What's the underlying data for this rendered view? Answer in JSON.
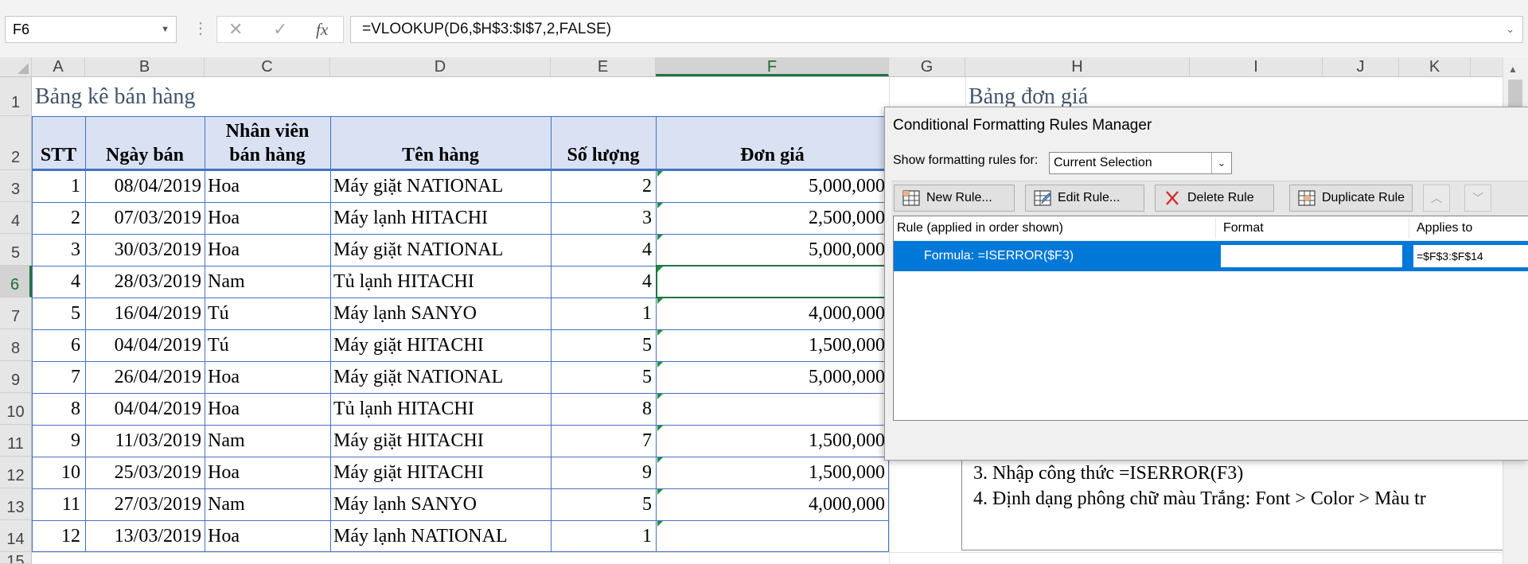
{
  "formula_bar": {
    "name_box": "F6",
    "cancel_icon": "✕",
    "enter_icon": "✓",
    "fx_label": "fx",
    "formula": "=VLOOKUP(D6,$H$3:$I$7,2,FALSE)"
  },
  "columns": [
    "A",
    "B",
    "C",
    "D",
    "E",
    "F",
    "G",
    "H",
    "I",
    "J",
    "K"
  ],
  "row_numbers": [
    "1",
    "2",
    "3",
    "4",
    "5",
    "6",
    "7",
    "8",
    "9",
    "10",
    "11",
    "12",
    "13",
    "14",
    "15"
  ],
  "sheet": {
    "title_left": "Bảng kê bán hàng",
    "title_right": "Bảng đơn giá",
    "headers": {
      "stt": "STT",
      "ngay_ban": "Ngày bán",
      "nhan_vien_line1": "Nhân viên",
      "nhan_vien_line2": "bán hàng",
      "ten_hang": "Tên hàng",
      "so_luong": "Số lượng",
      "don_gia": "Đơn giá"
    },
    "rows": [
      {
        "stt": "1",
        "ngay": "08/04/2019",
        "nv": "Hoa",
        "hang": "Máy giặt NATIONAL",
        "sl": "2",
        "gia": "5,000,000"
      },
      {
        "stt": "2",
        "ngay": "07/03/2019",
        "nv": "Hoa",
        "hang": "Máy lạnh HITACHI",
        "sl": "3",
        "gia": "2,500,000"
      },
      {
        "stt": "3",
        "ngay": "30/03/2019",
        "nv": "Hoa",
        "hang": "Máy giặt NATIONAL",
        "sl": "4",
        "gia": "5,000,000"
      },
      {
        "stt": "4",
        "ngay": "28/03/2019",
        "nv": "Nam",
        "hang": "Tủ lạnh HITACHI",
        "sl": "4",
        "gia": ""
      },
      {
        "stt": "5",
        "ngay": "16/04/2019",
        "nv": "Tú",
        "hang": "Máy lạnh SANYO",
        "sl": "1",
        "gia": "4,000,000"
      },
      {
        "stt": "6",
        "ngay": "04/04/2019",
        "nv": "Tú",
        "hang": "Máy giặt HITACHI",
        "sl": "5",
        "gia": "1,500,000"
      },
      {
        "stt": "7",
        "ngay": "26/04/2019",
        "nv": "Hoa",
        "hang": "Máy giặt NATIONAL",
        "sl": "5",
        "gia": "5,000,000"
      },
      {
        "stt": "8",
        "ngay": "04/04/2019",
        "nv": "Hoa",
        "hang": "Tủ lạnh HITACHI",
        "sl": "8",
        "gia": ""
      },
      {
        "stt": "9",
        "ngay": "11/03/2019",
        "nv": "Nam",
        "hang": "Máy giặt HITACHI",
        "sl": "7",
        "gia": "1,500,000"
      },
      {
        "stt": "10",
        "ngay": "25/03/2019",
        "nv": "Hoa",
        "hang": "Máy giặt HITACHI",
        "sl": "9",
        "gia": "1,500,000"
      },
      {
        "stt": "11",
        "ngay": "27/03/2019",
        "nv": "Nam",
        "hang": "Máy lạnh SANYO",
        "sl": "5",
        "gia": "4,000,000"
      },
      {
        "stt": "12",
        "ngay": "13/03/2019",
        "nv": "Hoa",
        "hang": "Máy lạnh NATIONAL",
        "sl": "1",
        "gia": ""
      }
    ],
    "instructions": {
      "line3": "3. Nhập công thức =ISERROR(F3)",
      "line4": "4. Định dạng phông chữ màu Trắng: Font > Color > Màu tr"
    }
  },
  "dialog": {
    "title": "Conditional Formatting Rules Manager",
    "show_label": "Show formatting rules for:",
    "show_value": "Current Selection",
    "buttons": {
      "new_rule": "New Rule...",
      "edit_rule": "Edit Rule...",
      "delete_rule": "Delete Rule",
      "duplicate_rule": "Duplicate Rule"
    },
    "columns": {
      "rule": "Rule (applied in order shown)",
      "format": "Format",
      "applies_to": "Applies to"
    },
    "rule_row": {
      "rule": "Formula: =ISERROR($F3)",
      "applies_to": "=$F$3:$F$14"
    }
  },
  "colors": {
    "selection_blue": "#0078d7",
    "header_fill": "#d9e1f2",
    "table_border": "#4472c4",
    "title_color": "#44546a",
    "excel_green": "#217346"
  }
}
